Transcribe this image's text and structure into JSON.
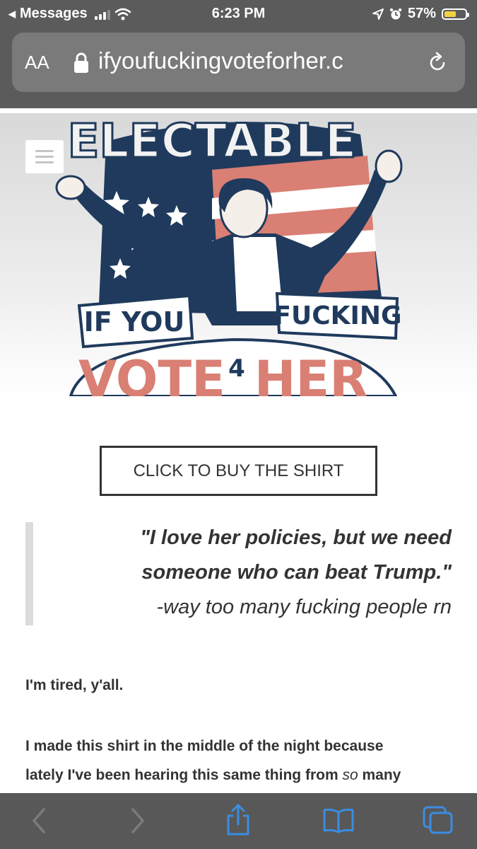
{
  "status_bar": {
    "back_app": "Messages",
    "time": "6:23 PM",
    "battery_percent": "57%",
    "battery_level": 0.57,
    "icons": [
      "back-triangle-icon",
      "signal-icon",
      "wifi-icon",
      "location-arrow-icon",
      "alarm-icon",
      "battery-icon"
    ]
  },
  "address_bar": {
    "text_size_label": "AA",
    "url": "ifyoufuckingvoteforher.c",
    "icons": [
      "lock-icon",
      "reload-icon"
    ]
  },
  "page": {
    "menu_icon": "hamburger-menu-icon",
    "hero_image": "Illustration of a woman in a dark jacket with arms raised in front of an American flag; hand-lettered banners read 'ELECTABLE', 'IF YOU', 'FUCKING', 'VOTE 4 HER'",
    "hero_lettering": [
      "ELECTABLE",
      "IF YOU",
      "FUCKING",
      "VOTE",
      "4",
      "HER"
    ],
    "buy_button": "CLICK TO BUY THE SHIRT",
    "quote": {
      "line1": "\"I love her policies, but we need",
      "line2": "someone who can beat Trump.\"",
      "attribution": "-way too many fucking people rn"
    },
    "paragraph1": "I'm tired, y'all.",
    "paragraph2_line1": "I made this shirt in the middle of the night because",
    "paragraph2_line2_before": "lately I've been hearing this same thing from ",
    "paragraph2_line2_em": "so",
    "paragraph2_line2_after": " many"
  },
  "toolbar": {
    "colors": {
      "active": "#3b8de0",
      "disabled": "#7b7b7b"
    },
    "items": [
      "back-icon",
      "forward-icon",
      "share-icon",
      "bookmarks-icon",
      "tabs-icon"
    ]
  }
}
